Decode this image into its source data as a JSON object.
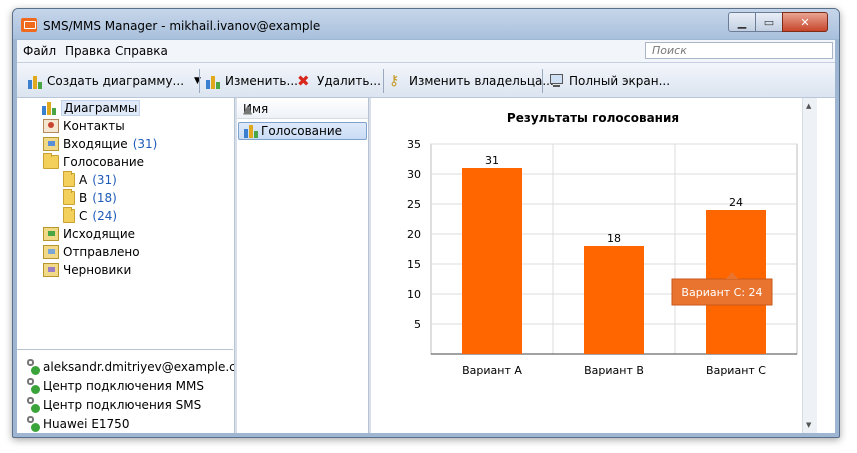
{
  "window": {
    "title": "SMS/MMS Manager - mikhail.ivanov@example"
  },
  "menu": {
    "items": [
      "Файл",
      "Правка",
      "Справка"
    ],
    "search_placeholder": "Поиск"
  },
  "toolbar": {
    "create_chart": "Создать диаграмму...",
    "edit": "Изменить...",
    "delete": "Удалить...",
    "change_owner": "Изменить владельца...",
    "fullscreen": "Полный экран..."
  },
  "tree": {
    "charts": "Диаграммы",
    "contacts": "Контакты",
    "inbox": "Входящие",
    "inbox_count": "(31)",
    "voting": "Голосование",
    "folder_a": "A",
    "folder_a_count": "(31)",
    "folder_b": "B",
    "folder_b_count": "(18)",
    "folder_c": "C",
    "folder_c_count": "(24)",
    "outbox": "Исходящие",
    "sent": "Отправлено",
    "drafts": "Черновики"
  },
  "accounts": [
    "aleksandr.dmitriyev@example.com",
    "Центр подключения MMS",
    "Центр подключения SMS",
    "Huawei E1750"
  ],
  "list": {
    "header": "Имя",
    "rows": [
      "Голосование"
    ]
  },
  "chart_data": {
    "type": "bar",
    "title": "Результаты голосования",
    "categories": [
      "Вариант A",
      "Вариант B",
      "Вариант C"
    ],
    "values": [
      31,
      18,
      24
    ],
    "ylim": [
      0,
      35
    ],
    "yticks": [
      5,
      10,
      15,
      20,
      25,
      30,
      35
    ],
    "grid": true,
    "bar_color": "#ff6600",
    "tooltip": "Вариант C: 24"
  }
}
